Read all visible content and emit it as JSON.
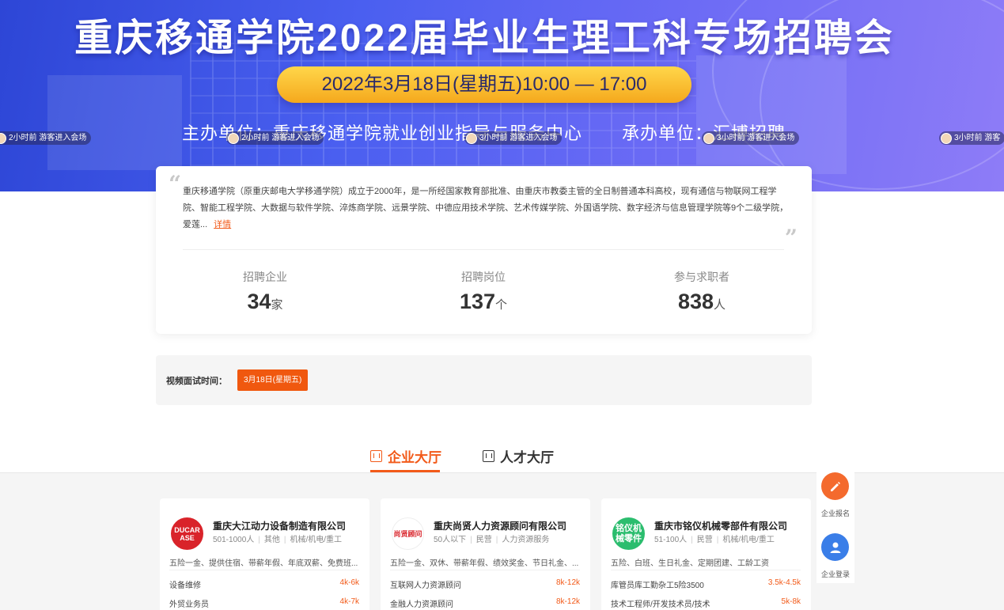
{
  "banner": {
    "title": "重庆移通学院2022届毕业生理工科专场招聘会",
    "date": "2022年3月18日(星期五)10:00 — 17:00",
    "host": "主办单位：重庆移通学院就业创业指导与服务中心",
    "organizer": "承办单位：汇博招聘",
    "tickers": [
      "2小时前 游客进入会场",
      "2小时前 游客进入会场",
      "3小时前 游客进入会场",
      "3小时前 游客进入会场",
      "3小时前 游客"
    ]
  },
  "intro": {
    "text": "重庆移通学院（原重庆邮电大学移通学院）成立于2000年，是一所经国家教育部批准、由重庆市教委主管的全日制普通本科高校，现有通信与物联网工程学院、智能工程学院、大数据与软件学院、淬炼商学院、远景学院、中德应用技术学院、艺术传媒学院、外国语学院、数字经济与信息管理学院等9个二级学院，爱莲...",
    "more_link": "详情",
    "stats": [
      {
        "label": "招聘企业",
        "value": "34",
        "unit": "家"
      },
      {
        "label": "招聘岗位",
        "value": "137",
        "unit": "个"
      },
      {
        "label": "参与求职者",
        "value": "838",
        "unit": "人"
      }
    ]
  },
  "video": {
    "label": "视频面试时间：",
    "date": "3月18日(星期五)"
  },
  "tabs": {
    "company": "企业大厅",
    "talent": "人才大厅"
  },
  "companies": [
    {
      "name": "重庆大江动力设备制造有限公司",
      "logo_text": "DUCAR ASE",
      "logo_color": "#d9232a",
      "size": "501-1000人",
      "type": "其他",
      "industry": "机械/机电/重工",
      "benefits": "五险一金、提供住宿、带薪年假、年底双薪、免费班...",
      "jobs": [
        {
          "title": "设备维修",
          "salary": "4k-6k"
        },
        {
          "title": "外贸业务员",
          "salary": "4k-7k"
        }
      ]
    },
    {
      "name": "重庆尚贤人力资源顾问有限公司",
      "logo_text": "尚贤顾问",
      "logo_color": "#ffffff",
      "size": "50人以下",
      "type": "民营",
      "industry": "人力资源服务",
      "benefits": "五险一金、双休、带薪年假、绩效奖金、节日礼金、...",
      "jobs": [
        {
          "title": "互联网人力资源顾问",
          "salary": "8k-12k"
        },
        {
          "title": "金融人力资源顾问",
          "salary": "8k-12k"
        }
      ]
    },
    {
      "name": "重庆市铭仪机械零部件有限公司",
      "logo_text": "铭仪机械零件",
      "logo_color": "#2bbd6e",
      "size": "51-100人",
      "type": "民营",
      "industry": "机械/机电/重工",
      "benefits": "五险、白班、生日礼金、定期团建、工龄工资",
      "jobs": [
        {
          "title": "库管员库工勤杂工5险3500",
          "salary": "3.5k-4.5k"
        },
        {
          "title": "技术工程师/开发技术员/技术",
          "salary": "5k-8k"
        }
      ]
    }
  ],
  "side": {
    "signup": "企业报名",
    "login": "企业登录"
  },
  "colors": {
    "accent": "#f25a19",
    "banner": "#4a5ff0",
    "pill": "#f5a81d",
    "login": "#3a7ee8"
  }
}
